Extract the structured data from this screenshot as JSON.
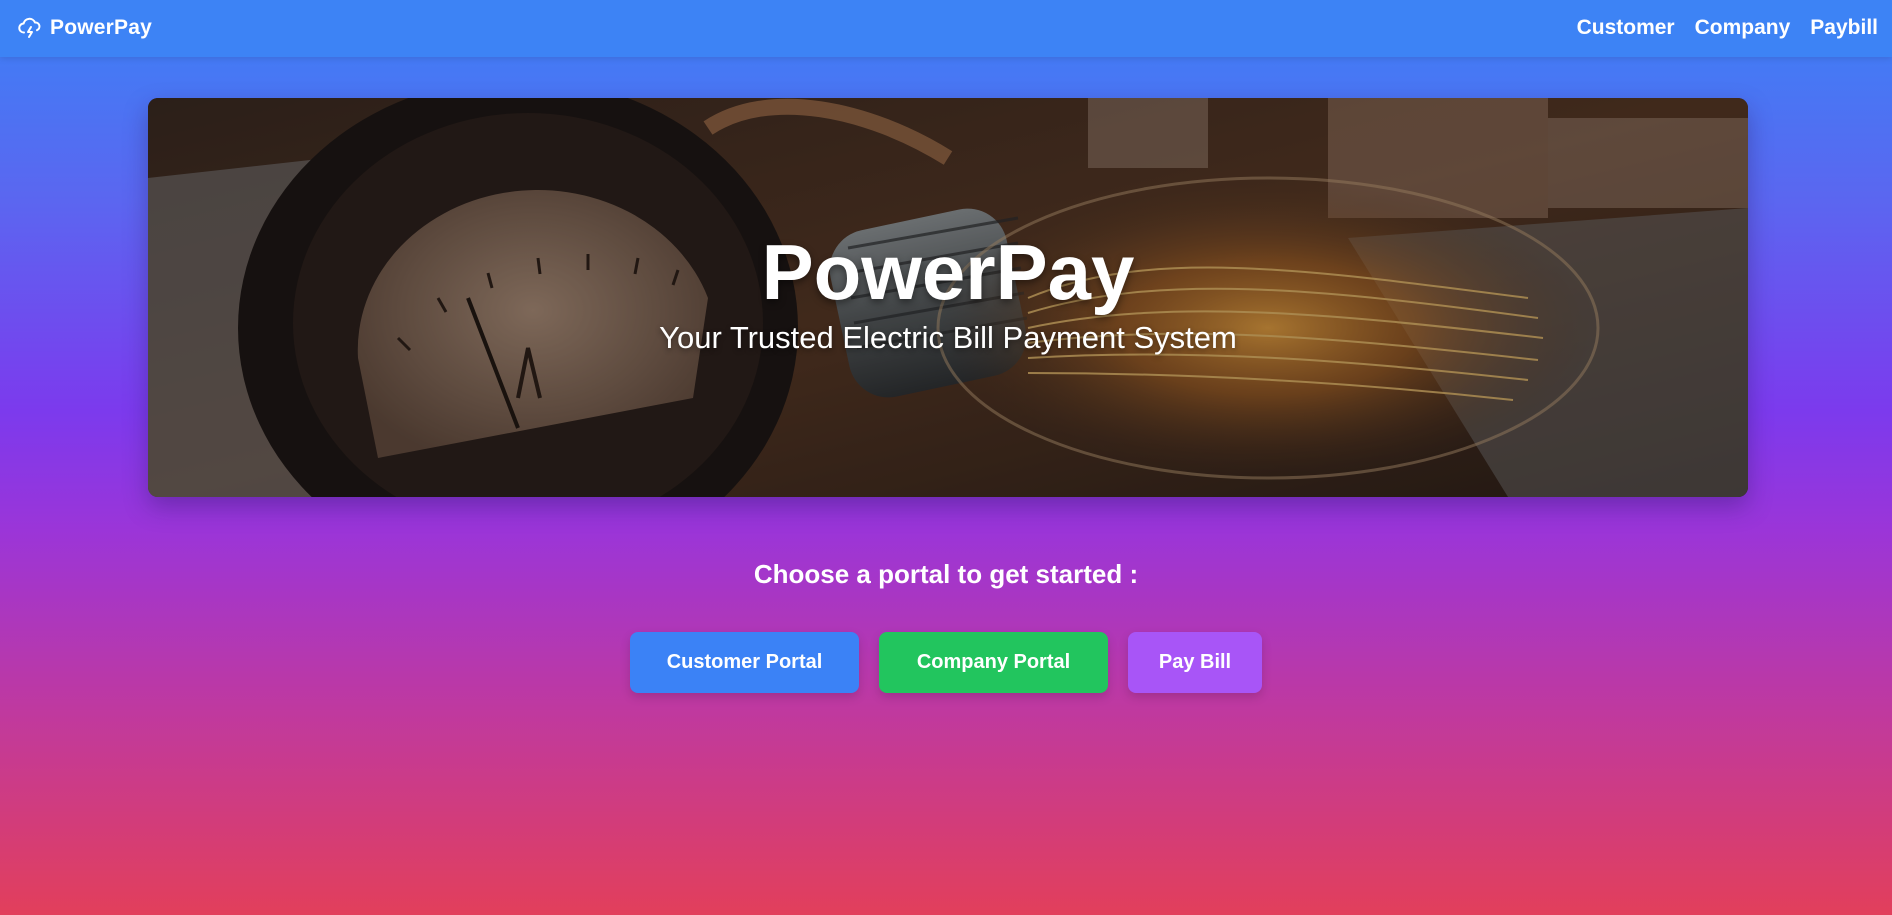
{
  "brand": {
    "name": "PowerPay",
    "icon": "cloud-lightning-icon"
  },
  "nav": {
    "links": [
      {
        "label": "Customer"
      },
      {
        "label": "Company"
      },
      {
        "label": "Paybill"
      }
    ]
  },
  "hero": {
    "title": "PowerPay",
    "subtitle": "Your Trusted Electric Bill Payment System",
    "image": "voltmeter-and-edison-bulb-photo"
  },
  "main": {
    "prompt": "Choose a portal to get started :",
    "buttons": [
      {
        "label": "Customer Portal",
        "color": "#3b82f6"
      },
      {
        "label": "Company Portal",
        "color": "#22c55e"
      },
      {
        "label": "Pay Bill",
        "color": "#a855f7"
      }
    ]
  },
  "colors": {
    "navbar": "#3d83f5",
    "gradient_top": "#3b82f6",
    "gradient_mid": "#7c3aed",
    "gradient_bottom": "#e23f5b"
  }
}
